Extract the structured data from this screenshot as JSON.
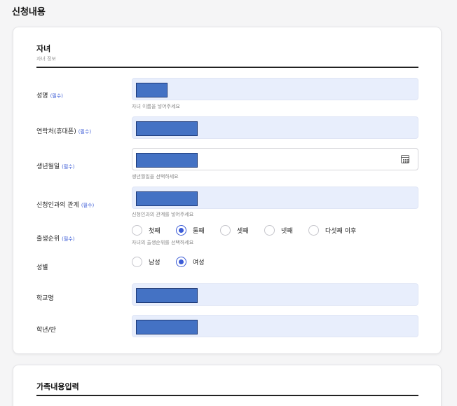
{
  "page_title": "신청내용",
  "child_section": {
    "title": "자녀",
    "subtitle": "자녀 정보",
    "required_tag": "(필수)",
    "fields": {
      "name": {
        "label": "성명",
        "hint": "자녀 이름을 넣어주세요"
      },
      "phone": {
        "label": "연락처(휴대폰)"
      },
      "birth": {
        "label": "생년월일",
        "hint": "생년월일을 선택하세요"
      },
      "relation": {
        "label": "신청인과의 관계",
        "hint": "신청인과의 관계를 넣어주세요"
      },
      "birth_order": {
        "label": "출생순위",
        "hint": "자녀의 출생순위를 선택하세요",
        "options": [
          "첫째",
          "둘째",
          "셋째",
          "넷째",
          "다섯째 이후"
        ],
        "selected": "둘째"
      },
      "gender": {
        "label": "성별",
        "options": [
          "남성",
          "여성"
        ],
        "selected": "여성"
      },
      "school": {
        "label": "학교명"
      },
      "grade_class": {
        "label": "학년/반"
      }
    }
  },
  "family_section": {
    "title": "가족내용입력"
  },
  "colors": {
    "accent": "#3b5bd6",
    "input_bg": "#e8eefc",
    "redaction": "#4472c4"
  },
  "icons": {
    "date_picker": "calendar-icon"
  }
}
